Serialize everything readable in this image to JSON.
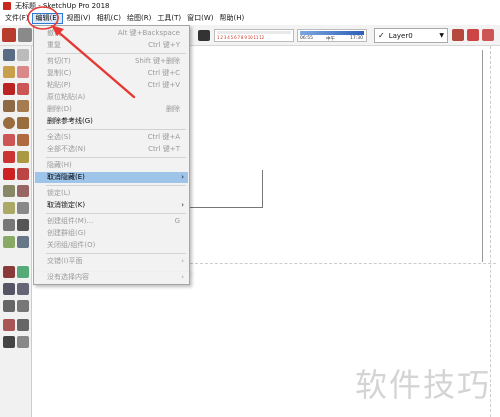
{
  "window": {
    "title": "无标题 - SketchUp Pro 2018"
  },
  "menubar": {
    "items": [
      {
        "label": "文件(F)"
      },
      {
        "label": "编辑(E)"
      },
      {
        "label": "视图(V)"
      },
      {
        "label": "相机(C)"
      },
      {
        "label": "绘图(R)"
      },
      {
        "label": "工具(T)"
      },
      {
        "label": "窗口(W)"
      },
      {
        "label": "帮助(H)"
      }
    ]
  },
  "toolbar": {
    "shadow_scale": "1 2 3 4 5 6 7 8 9 10 11 12",
    "time_left": "06:55",
    "time_mid": "中午",
    "time_right": "17:30",
    "layer_checked": "✓",
    "layer_name": "Layer0"
  },
  "edit_menu": {
    "items": [
      {
        "label": "撤销",
        "shortcut": "Alt 键+Backspace",
        "disabled": true
      },
      {
        "label": "重复",
        "shortcut": "Ctrl 键+Y",
        "disabled": true
      },
      {
        "label": "剪切(T)",
        "shortcut": "Shift 键+删除",
        "disabled": true
      },
      {
        "label": "复制(C)",
        "shortcut": "Ctrl 键+C",
        "disabled": true
      },
      {
        "label": "粘贴(P)",
        "shortcut": "Ctrl 键+V",
        "disabled": true
      },
      {
        "label": "原位粘贴(A)",
        "shortcut": "",
        "disabled": true
      },
      {
        "label": "删除(D)",
        "shortcut": "删除",
        "disabled": true
      },
      {
        "label": "删除参考线(G)",
        "shortcut": "",
        "disabled": false
      },
      {
        "label": "全选(S)",
        "shortcut": "Ctrl 键+A",
        "disabled": true
      },
      {
        "label": "全部不选(N)",
        "shortcut": "Ctrl 键+T",
        "disabled": true
      },
      {
        "label": "隐藏(H)",
        "shortcut": "",
        "disabled": true
      },
      {
        "label": "取消隐藏(E)",
        "shortcut": "",
        "disabled": false,
        "highlighted": true
      },
      {
        "label": "锁定(L)",
        "shortcut": "",
        "disabled": true
      },
      {
        "label": "取消锁定(K)",
        "shortcut": "",
        "disabled": false
      },
      {
        "label": "创建组件(M)...",
        "shortcut": "G",
        "disabled": true
      },
      {
        "label": "创建群组(G)",
        "shortcut": "",
        "disabled": true
      },
      {
        "label": "关闭组/组件(O)",
        "shortcut": "",
        "disabled": true
      },
      {
        "label": "交错(I)平面",
        "shortcut": "",
        "disabled": true
      },
      {
        "label": "没有选择内容",
        "shortcut": "",
        "disabled": true
      }
    ]
  },
  "watermark": "软件技巧",
  "colors": {
    "annotation": "#e53935",
    "highlight": "#9fc4ea",
    "menu_bg": "#f2f2f2"
  }
}
